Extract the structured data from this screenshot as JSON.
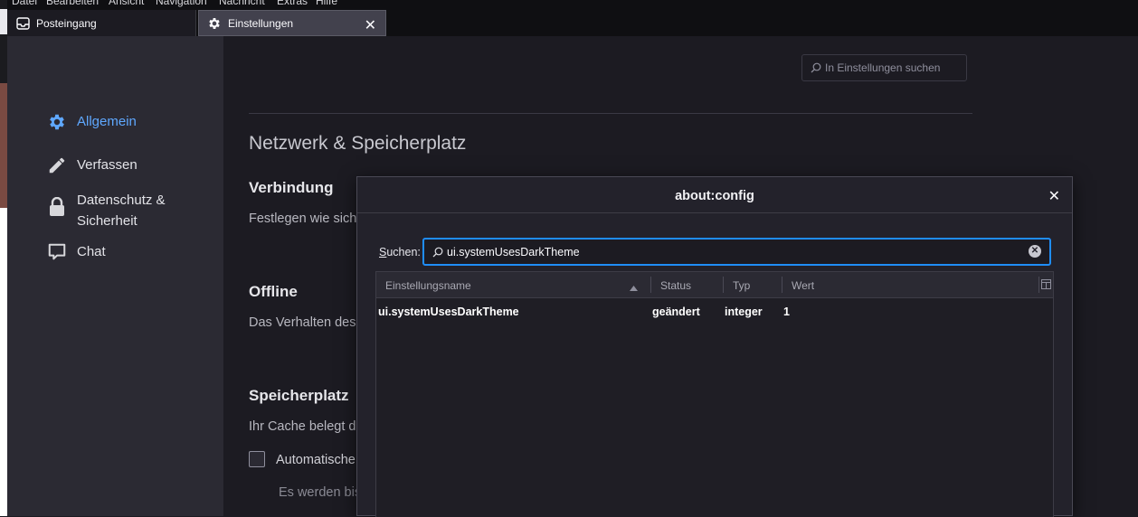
{
  "menubar": {
    "items": [
      "Datei",
      "Bearbeiten",
      "Ansicht",
      "Navigation",
      "Nachricht",
      "Extras",
      "Hilfe"
    ]
  },
  "tabs": [
    {
      "label": "Posteingang",
      "icon": "inbox-icon"
    },
    {
      "label": "Einstellungen",
      "icon": "gear-icon",
      "close": "✕"
    }
  ],
  "sidebar": {
    "items": [
      {
        "label": "Allgemein",
        "icon": "gear-icon",
        "active": true
      },
      {
        "label": "Verfassen",
        "icon": "pencil-icon"
      },
      {
        "label": "Datenschutz &",
        "label2": "Sicherheit",
        "icon": "lock-icon"
      },
      {
        "label": "Chat",
        "icon": "chat-icon"
      }
    ]
  },
  "settings": {
    "search_placeholder": "In Einstellungen suchen",
    "section_title": "Netzwerk & Speicherplatz",
    "verbindung": {
      "heading": "Verbindung",
      "text": "Festlegen wie sich"
    },
    "offline": {
      "heading": "Offline",
      "text": "Das Verhalten des"
    },
    "speicherplatz": {
      "heading": "Speicherplatz",
      "text": "Ihr Cache belegt d",
      "checkbox_label": "Automatische",
      "subtext": "Es werden bis"
    }
  },
  "dialog": {
    "title": "about:config",
    "close": "✕",
    "search_label_underlined": "S",
    "search_label_rest": "uchen:",
    "search_value": "ui.systemUsesDarkTheme",
    "columns": [
      "Einstellungsname",
      "Status",
      "Typ",
      "Wert"
    ],
    "rows": [
      {
        "name": "ui.systemUsesDarkTheme",
        "status": "geändert",
        "type": "integer",
        "value": "1"
      }
    ]
  },
  "colors": {
    "accent": "#1f8df8",
    "active_nav": "#5fa8ff",
    "background": "#1c1b22",
    "sidebar": "#2b2a33"
  }
}
